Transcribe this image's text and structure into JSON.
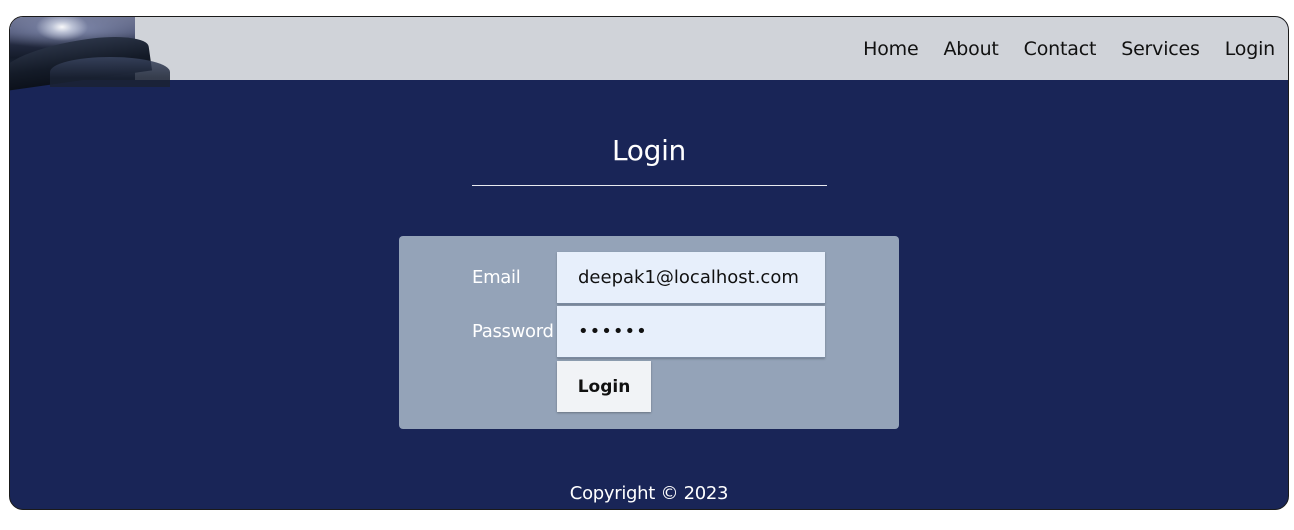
{
  "nav": {
    "logo_icon": "ocean-wave-logo",
    "links": [
      "Home",
      "About",
      "Contact",
      "Services",
      "Login"
    ]
  },
  "main": {
    "title": "Login",
    "form": {
      "email_label": "Email",
      "email_value": "deepak1@localhost.com",
      "password_label": "Password",
      "password_value": "dummyx",
      "submit_label": "Login"
    }
  },
  "footer": {
    "text": "Copyright © 2023"
  },
  "colors": {
    "navbar_bg": "#d0d3d9",
    "page_bg": "#192557",
    "card_bg": "#94a3b8",
    "input_bg": "#e7effb",
    "button_bg": "#f1f3f6"
  }
}
